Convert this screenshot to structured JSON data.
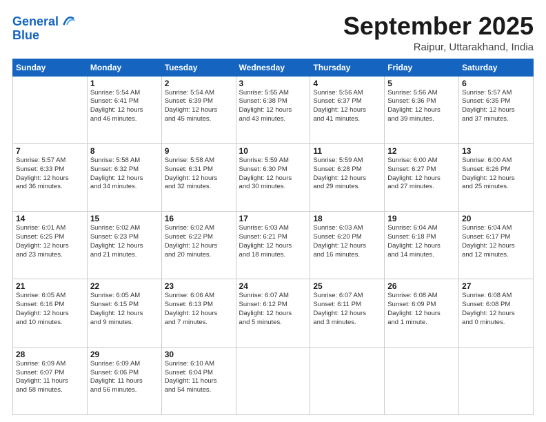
{
  "header": {
    "logo_line1": "General",
    "logo_line2": "Blue",
    "month": "September 2025",
    "location": "Raipur, Uttarakhand, India"
  },
  "weekdays": [
    "Sunday",
    "Monday",
    "Tuesday",
    "Wednesday",
    "Thursday",
    "Friday",
    "Saturday"
  ],
  "weeks": [
    [
      {
        "day": "",
        "info": ""
      },
      {
        "day": "1",
        "info": "Sunrise: 5:54 AM\nSunset: 6:41 PM\nDaylight: 12 hours\nand 46 minutes."
      },
      {
        "day": "2",
        "info": "Sunrise: 5:54 AM\nSunset: 6:39 PM\nDaylight: 12 hours\nand 45 minutes."
      },
      {
        "day": "3",
        "info": "Sunrise: 5:55 AM\nSunset: 6:38 PM\nDaylight: 12 hours\nand 43 minutes."
      },
      {
        "day": "4",
        "info": "Sunrise: 5:56 AM\nSunset: 6:37 PM\nDaylight: 12 hours\nand 41 minutes."
      },
      {
        "day": "5",
        "info": "Sunrise: 5:56 AM\nSunset: 6:36 PM\nDaylight: 12 hours\nand 39 minutes."
      },
      {
        "day": "6",
        "info": "Sunrise: 5:57 AM\nSunset: 6:35 PM\nDaylight: 12 hours\nand 37 minutes."
      }
    ],
    [
      {
        "day": "7",
        "info": "Sunrise: 5:57 AM\nSunset: 6:33 PM\nDaylight: 12 hours\nand 36 minutes."
      },
      {
        "day": "8",
        "info": "Sunrise: 5:58 AM\nSunset: 6:32 PM\nDaylight: 12 hours\nand 34 minutes."
      },
      {
        "day": "9",
        "info": "Sunrise: 5:58 AM\nSunset: 6:31 PM\nDaylight: 12 hours\nand 32 minutes."
      },
      {
        "day": "10",
        "info": "Sunrise: 5:59 AM\nSunset: 6:30 PM\nDaylight: 12 hours\nand 30 minutes."
      },
      {
        "day": "11",
        "info": "Sunrise: 5:59 AM\nSunset: 6:28 PM\nDaylight: 12 hours\nand 29 minutes."
      },
      {
        "day": "12",
        "info": "Sunrise: 6:00 AM\nSunset: 6:27 PM\nDaylight: 12 hours\nand 27 minutes."
      },
      {
        "day": "13",
        "info": "Sunrise: 6:00 AM\nSunset: 6:26 PM\nDaylight: 12 hours\nand 25 minutes."
      }
    ],
    [
      {
        "day": "14",
        "info": "Sunrise: 6:01 AM\nSunset: 6:25 PM\nDaylight: 12 hours\nand 23 minutes."
      },
      {
        "day": "15",
        "info": "Sunrise: 6:02 AM\nSunset: 6:23 PM\nDaylight: 12 hours\nand 21 minutes."
      },
      {
        "day": "16",
        "info": "Sunrise: 6:02 AM\nSunset: 6:22 PM\nDaylight: 12 hours\nand 20 minutes."
      },
      {
        "day": "17",
        "info": "Sunrise: 6:03 AM\nSunset: 6:21 PM\nDaylight: 12 hours\nand 18 minutes."
      },
      {
        "day": "18",
        "info": "Sunrise: 6:03 AM\nSunset: 6:20 PM\nDaylight: 12 hours\nand 16 minutes."
      },
      {
        "day": "19",
        "info": "Sunrise: 6:04 AM\nSunset: 6:18 PM\nDaylight: 12 hours\nand 14 minutes."
      },
      {
        "day": "20",
        "info": "Sunrise: 6:04 AM\nSunset: 6:17 PM\nDaylight: 12 hours\nand 12 minutes."
      }
    ],
    [
      {
        "day": "21",
        "info": "Sunrise: 6:05 AM\nSunset: 6:16 PM\nDaylight: 12 hours\nand 10 minutes."
      },
      {
        "day": "22",
        "info": "Sunrise: 6:05 AM\nSunset: 6:15 PM\nDaylight: 12 hours\nand 9 minutes."
      },
      {
        "day": "23",
        "info": "Sunrise: 6:06 AM\nSunset: 6:13 PM\nDaylight: 12 hours\nand 7 minutes."
      },
      {
        "day": "24",
        "info": "Sunrise: 6:07 AM\nSunset: 6:12 PM\nDaylight: 12 hours\nand 5 minutes."
      },
      {
        "day": "25",
        "info": "Sunrise: 6:07 AM\nSunset: 6:11 PM\nDaylight: 12 hours\nand 3 minutes."
      },
      {
        "day": "26",
        "info": "Sunrise: 6:08 AM\nSunset: 6:09 PM\nDaylight: 12 hours\nand 1 minute."
      },
      {
        "day": "27",
        "info": "Sunrise: 6:08 AM\nSunset: 6:08 PM\nDaylight: 12 hours\nand 0 minutes."
      }
    ],
    [
      {
        "day": "28",
        "info": "Sunrise: 6:09 AM\nSunset: 6:07 PM\nDaylight: 11 hours\nand 58 minutes."
      },
      {
        "day": "29",
        "info": "Sunrise: 6:09 AM\nSunset: 6:06 PM\nDaylight: 11 hours\nand 56 minutes."
      },
      {
        "day": "30",
        "info": "Sunrise: 6:10 AM\nSunset: 6:04 PM\nDaylight: 11 hours\nand 54 minutes."
      },
      {
        "day": "",
        "info": ""
      },
      {
        "day": "",
        "info": ""
      },
      {
        "day": "",
        "info": ""
      },
      {
        "day": "",
        "info": ""
      }
    ]
  ]
}
